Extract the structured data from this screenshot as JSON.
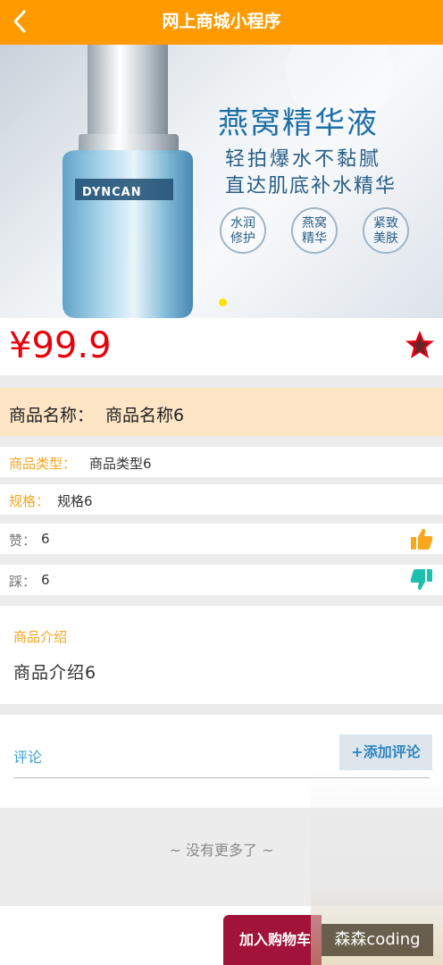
{
  "header": {
    "title": "网上商城小程序",
    "back_icon": "chevron-left-icon"
  },
  "banner": {
    "headline": "燕窝精华液",
    "subline1": "轻拍爆水不黏腻",
    "subline2": "直达肌底补水精华",
    "badges": [
      {
        "line1": "水润",
        "line2": "修护"
      },
      {
        "line1": "燕窝",
        "line2": "精华"
      },
      {
        "line1": "紧致",
        "line2": "美肤"
      }
    ],
    "brand_text": "DYNCAN",
    "active_dot_color": "#ffe000"
  },
  "product": {
    "price": "¥99.9",
    "favorite_icon": "star-icon",
    "name_label": "商品名称：",
    "name_value": "商品名称6",
    "type_label": "商品类型：",
    "type_value": "商品类型6",
    "spec_label": "规格：",
    "spec_value": "规格6",
    "likes_label": "赞：",
    "likes_value": "6",
    "dislikes_label": "踩：",
    "dislikes_value": "6",
    "intro_label": "商品介绍",
    "intro_value": "商品介绍6"
  },
  "comments": {
    "label": "评论",
    "add_button": "+添加评论",
    "empty_text": "~ 没有更多了 ~"
  },
  "footer": {
    "cart_button": "加入购物车"
  },
  "watermark": {
    "text": "森森coding"
  },
  "colors": {
    "header": "#ff9b00",
    "price": "#e8000b",
    "accent_orange": "#f5a623",
    "link_blue": "#3aa0d2",
    "cart_button": "#a11338"
  }
}
